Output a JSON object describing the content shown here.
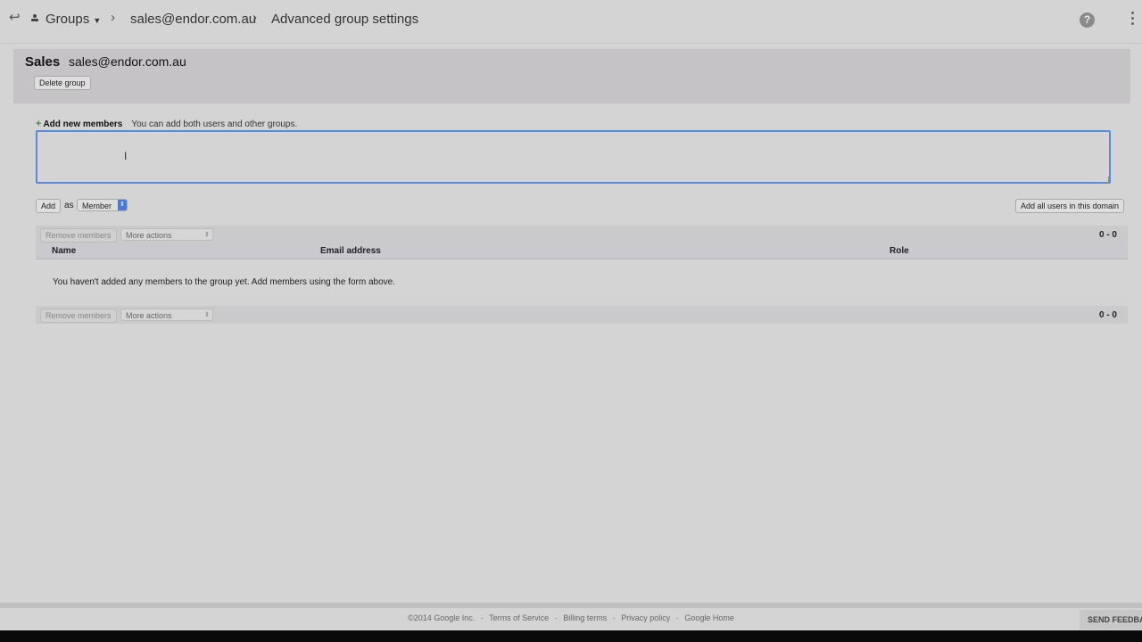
{
  "topbar": {
    "back_icon": "back-arrow-icon",
    "breadcrumb": {
      "groups": "Groups",
      "group_email": "sales@endor.com.au",
      "current": "Advanced group settings"
    },
    "help_icon": "help-icon",
    "more_icon": "more-vert-icon"
  },
  "group": {
    "name": "Sales",
    "email": "sales@endor.com.au",
    "delete_label": "Delete group"
  },
  "add_members": {
    "title": "Add new members",
    "hint": "You can add both users and other groups.",
    "input_value": "",
    "add_label": "Add",
    "as_label": "as",
    "role_selected": "Member",
    "add_all_label": "Add all users in this domain"
  },
  "members_table": {
    "remove_label": "Remove members",
    "more_actions_label": "More actions",
    "count": "0 - 0",
    "columns": [
      "Name",
      "Email address",
      "Role"
    ],
    "empty_message": "You haven't added any members to the group yet. Add members using the form above."
  },
  "footer": {
    "copyright": "©2014 Google Inc.",
    "links": [
      "Terms of Service",
      "Billing terms",
      "Privacy policy",
      "Google Home"
    ],
    "feedback_label": "SEND FEEDBACK"
  },
  "colors": {
    "focus_border": "#5a8bd8",
    "select_accent": "#4a7ad6",
    "plus": "#3a8f3a"
  }
}
